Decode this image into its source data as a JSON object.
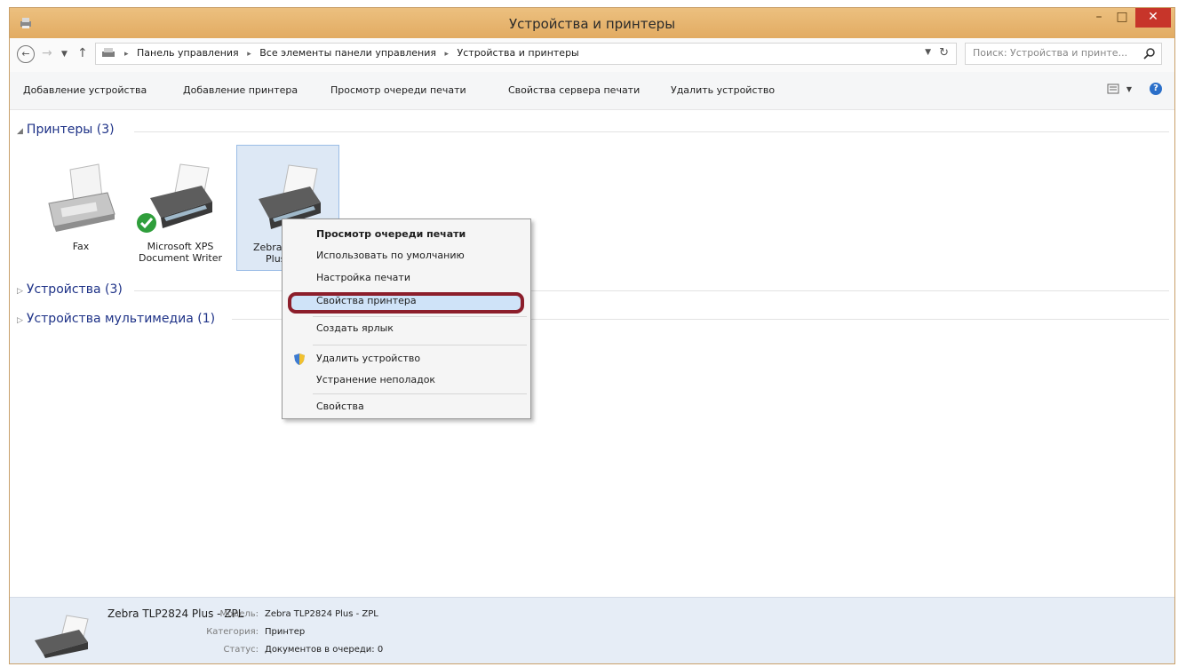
{
  "window": {
    "title": "Устройства и принтеры"
  },
  "address": {
    "crumbs": [
      "Панель управления",
      "Все элементы панели управления",
      "Устройства и принтеры"
    ],
    "search_placeholder": "Поиск: Устройства и принте..."
  },
  "commands": [
    "Добавление устройства",
    "Добавление принтера",
    "Просмотр очереди печати",
    "Свойства сервера печати",
    "Удалить устройство"
  ],
  "groups": {
    "printers": "Принтеры (3)",
    "devices": "Устройства (3)",
    "multimedia": "Устройства мультимедиа (1)"
  },
  "devices": [
    {
      "line1": "Fax",
      "line2": ""
    },
    {
      "line1": "Microsoft XPS",
      "line2": "Document Writer",
      "default": true
    },
    {
      "line1": "Zebra",
      "line2": "Plus",
      "selected": true
    }
  ],
  "context_menu": {
    "items": [
      "Просмотр очереди печати",
      "Использовать по умолчанию",
      "Настройка печати",
      "Свойства принтера",
      "Создать ярлык",
      "Удалить устройство",
      "Устранение неполадок",
      "Свойства"
    ],
    "highlighted_index": 3,
    "highlight_color": "#8c1e2b"
  },
  "details": {
    "name": "Zebra TLP2824 Plus - ZPL",
    "model_label": "Модель:",
    "model_value": "Zebra TLP2824 Plus - ZPL",
    "category_label": "Категория:",
    "category_value": "Принтер",
    "status_label": "Статус:",
    "status_value": "Документов в очереди: 0"
  },
  "colors": {
    "titlebar": "#e8b46c",
    "close_button": "#c7352a",
    "group_header": "#1e3287",
    "selection": "#dde8f5",
    "details_pane": "#e6edf6"
  }
}
